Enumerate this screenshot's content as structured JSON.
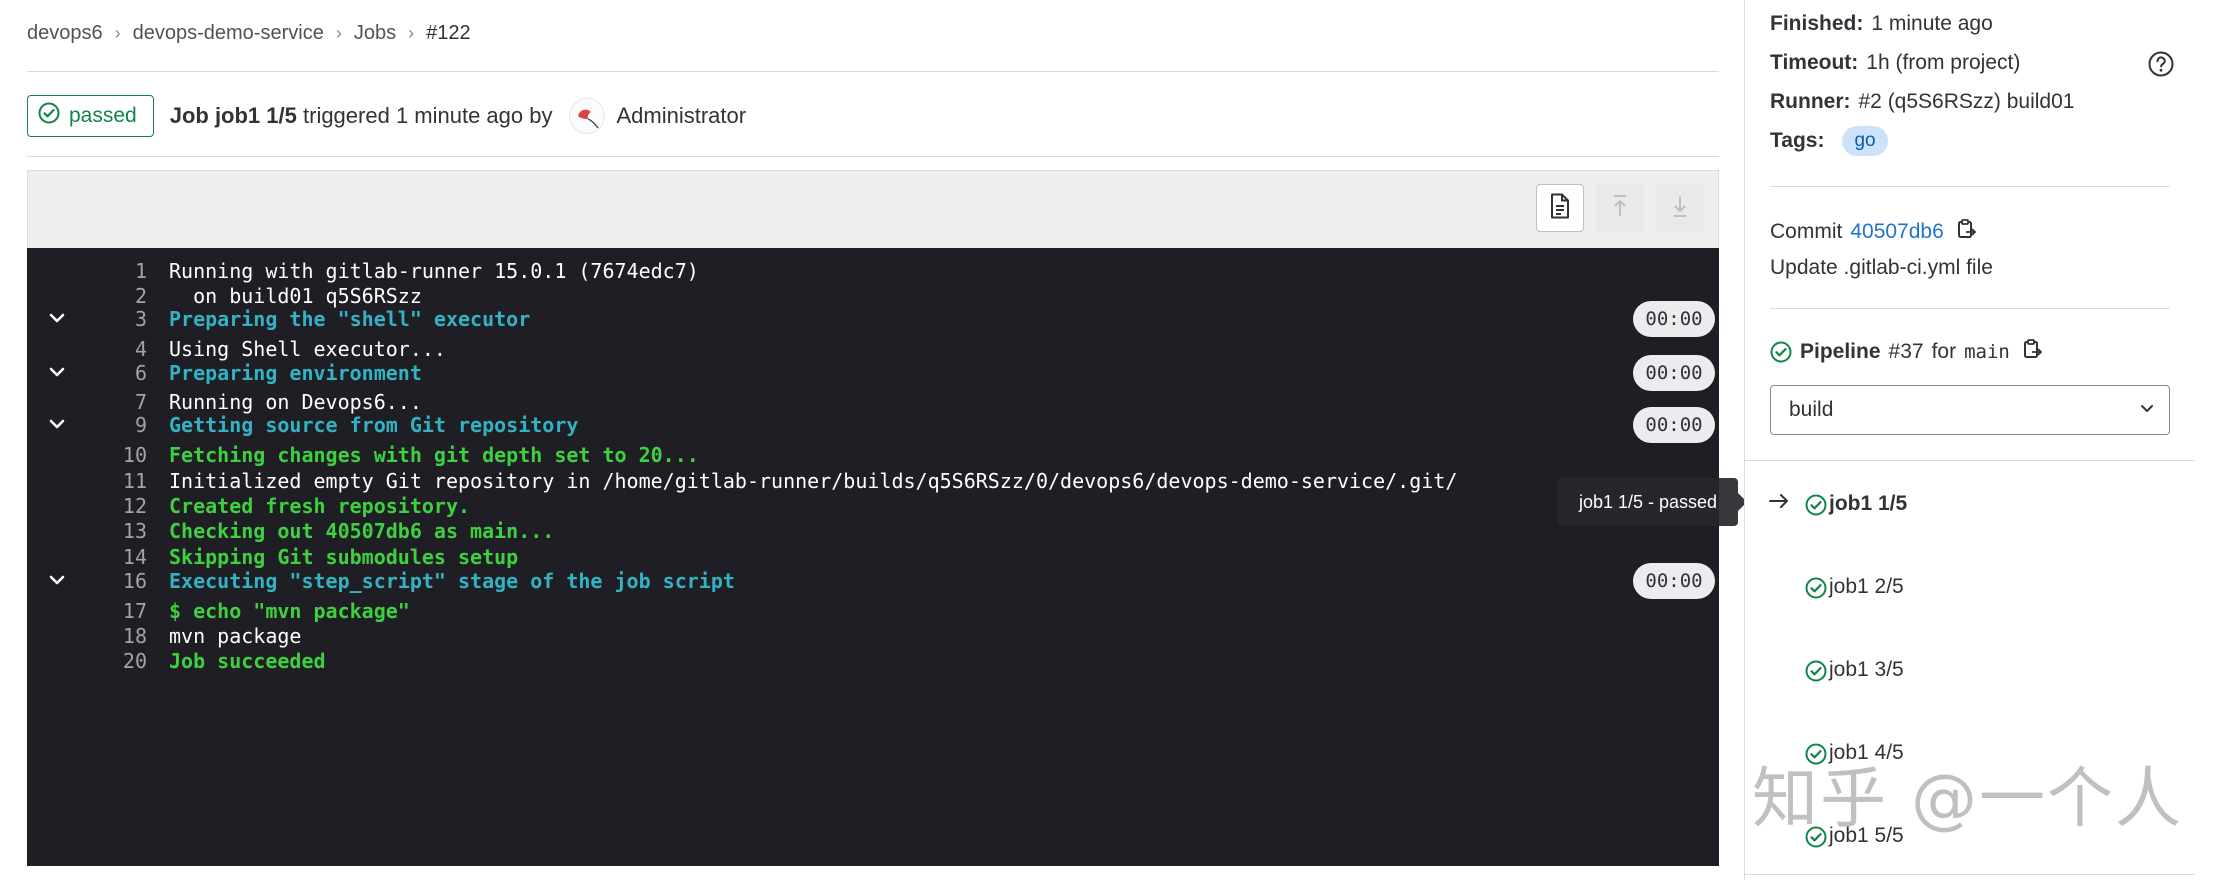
{
  "breadcrumb": {
    "items": [
      "devops6",
      "devops-demo-service",
      "Jobs",
      "#122"
    ]
  },
  "job": {
    "status_label": "passed",
    "title_bold": "Job job1 1/5",
    "triggered_text": "triggered 1 minute ago by",
    "user": "Administrator"
  },
  "log": {
    "lines": [
      {
        "num": "1",
        "text": "Running with gitlab-runner 15.0.1 (7674edc7)",
        "color": "white",
        "collapsible": false,
        "duration": ""
      },
      {
        "num": "2",
        "text": "  on build01 q5S6RSzz",
        "color": "white",
        "collapsible": false,
        "duration": ""
      },
      {
        "num": "3",
        "text": "Preparing the \"shell\" executor",
        "color": "cyan",
        "collapsible": true,
        "duration": "00:00"
      },
      {
        "num": "4",
        "text": "Using Shell executor...",
        "color": "white",
        "collapsible": false,
        "duration": ""
      },
      {
        "num": "6",
        "text": "Preparing environment",
        "color": "cyan",
        "collapsible": true,
        "duration": "00:00"
      },
      {
        "num": "7",
        "text": "Running on Devops6...",
        "color": "white",
        "collapsible": false,
        "duration": ""
      },
      {
        "num": "9",
        "text": "Getting source from Git repository",
        "color": "cyan",
        "collapsible": true,
        "duration": "00:00"
      },
      {
        "num": "10",
        "text": "Fetching changes with git depth set to 20...",
        "color": "green",
        "collapsible": false,
        "duration": ""
      },
      {
        "num": "11",
        "text": "Initialized empty Git repository in /home/gitlab-runner/builds/q5S6RSzz/0/devops6/devops-demo-service/.git/",
        "color": "white",
        "collapsible": false,
        "duration": ""
      },
      {
        "num": "12",
        "text": "Created fresh repository.",
        "color": "green",
        "collapsible": false,
        "duration": ""
      },
      {
        "num": "13",
        "text": "Checking out 40507db6 as main...",
        "color": "green",
        "collapsible": false,
        "duration": ""
      },
      {
        "num": "14",
        "text": "Skipping Git submodules setup",
        "color": "green",
        "collapsible": false,
        "duration": ""
      },
      {
        "num": "16",
        "text": "Executing \"step_script\" stage of the job script",
        "color": "cyan",
        "collapsible": true,
        "duration": "00:00"
      },
      {
        "num": "17",
        "text": "$ echo \"mvn package\"",
        "color": "green",
        "collapsible": false,
        "duration": ""
      },
      {
        "num": "18",
        "text": "mvn package",
        "color": "white",
        "collapsible": false,
        "duration": ""
      },
      {
        "num": "20",
        "text": "Job succeeded",
        "color": "green",
        "collapsible": false,
        "duration": ""
      }
    ]
  },
  "sidebar": {
    "finished_label": "Finished:",
    "finished_value": "1 minute ago",
    "timeout_label": "Timeout:",
    "timeout_value": "1h (from project)",
    "runner_label": "Runner:",
    "runner_value": "#2 (q5S6RSzz) build01",
    "tags_label": "Tags:",
    "tag": "go",
    "commit_label": "Commit",
    "commit_sha": "40507db6",
    "commit_message": "Update .gitlab-ci.yml file",
    "pipeline_label": "Pipeline",
    "pipeline_id": "#37",
    "pipeline_for": "for",
    "pipeline_ref": "main",
    "stage_selected": "build",
    "jobs": [
      "job1 1/5",
      "job1 2/5",
      "job1 3/5",
      "job1 4/5",
      "job1 5/5"
    ]
  },
  "tooltip": {
    "text": "job1 1/5 - passed"
  },
  "watermark": {
    "text": "知乎 @一个人"
  },
  "colors": {
    "success": "#108548",
    "link": "#1f75cb",
    "log_bg": "#1f1e24",
    "log_cyan": "#32b3c4",
    "log_green": "#3ed13f"
  }
}
